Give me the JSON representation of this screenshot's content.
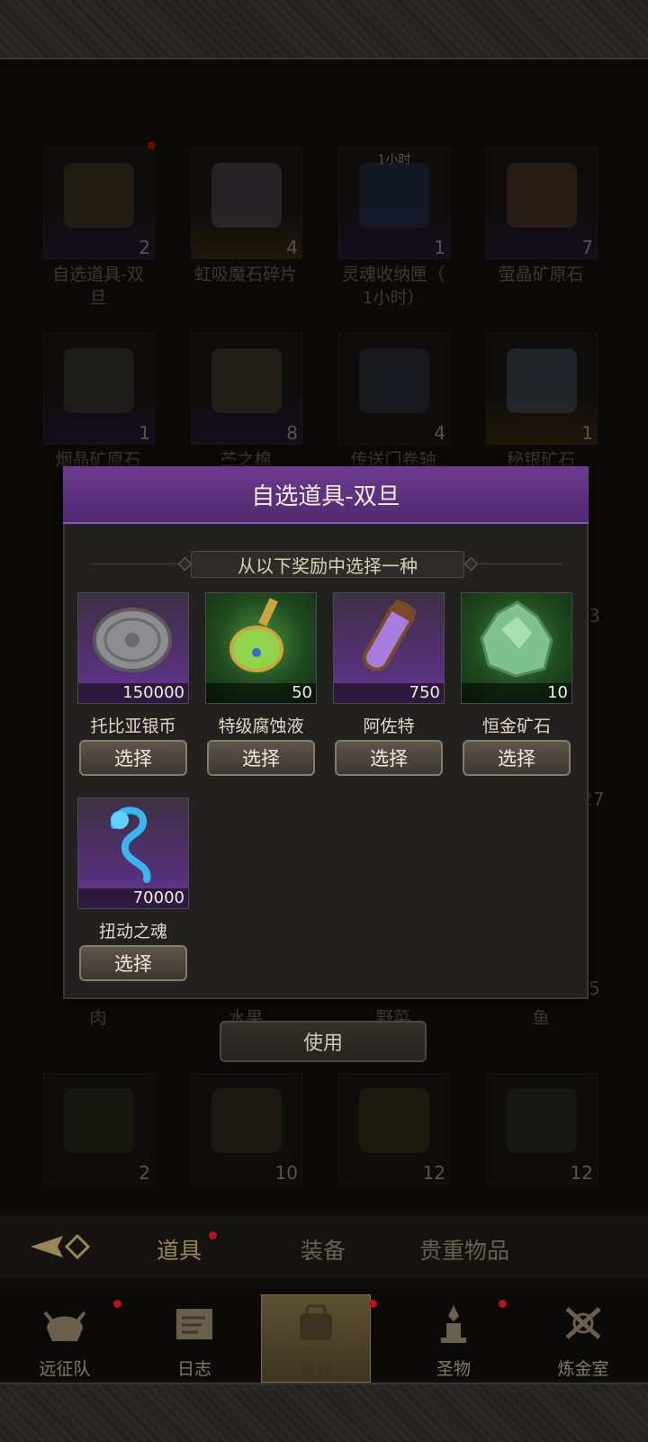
{
  "inventory": {
    "row1": [
      {
        "label": "自选道具-双\n旦",
        "count": "2",
        "note": ""
      },
      {
        "label": "虹吸魔石碎片",
        "count": "4",
        "note": ""
      },
      {
        "label": "灵魂收纳匣（\n1小时）",
        "count": "1",
        "note": "1小时"
      },
      {
        "label": "萤晶矿原石",
        "count": "7",
        "note": ""
      }
    ],
    "row2": [
      {
        "label": "烟晶矿原石",
        "count": "1"
      },
      {
        "label": "苎之棉",
        "count": "8"
      },
      {
        "label": "传送门卷轴",
        "count": "4"
      },
      {
        "label": "秘银矿石",
        "count": "1"
      }
    ],
    "row_labels_hidden": [
      "肉",
      "水果",
      "野菜",
      "鱼"
    ],
    "row_last": [
      {
        "count": "2"
      },
      {
        "count": "10"
      },
      {
        "count": "12"
      },
      {
        "count": "12"
      }
    ],
    "edge_counts": [
      "3",
      "27",
      "5"
    ]
  },
  "modal": {
    "title": "自选道具-双旦",
    "subtitle": "从以下奖励中选择一种",
    "select_label": "选择",
    "rewards": [
      {
        "name": "托比亚银币",
        "count": "150000",
        "icon": "silver-coin-icon"
      },
      {
        "name": "特级腐蚀液",
        "count": "50",
        "icon": "potion-flask-icon"
      },
      {
        "name": "阿佐特",
        "count": "750",
        "icon": "crystal-vial-icon"
      },
      {
        "name": "恒金矿石",
        "count": "10",
        "icon": "green-ore-icon"
      },
      {
        "name": "扭动之魂",
        "count": "70000",
        "icon": "wisp-soul-icon"
      }
    ]
  },
  "use_button": "使用",
  "tabs": [
    {
      "label": "道具",
      "active": true
    },
    {
      "label": "装备",
      "active": false
    },
    {
      "label": "贵重物品",
      "active": false
    }
  ],
  "nav": [
    {
      "label": "远征队",
      "icon": "helmet-icon",
      "active": false
    },
    {
      "label": "日志",
      "icon": "scroll-icon",
      "active": false
    },
    {
      "label": "背包",
      "icon": "backpack-icon",
      "active": true
    },
    {
      "label": "圣物",
      "icon": "relic-icon",
      "active": false
    },
    {
      "label": "炼金室",
      "icon": "alchemy-icon",
      "active": false
    }
  ],
  "colors": {
    "accent_purple": "#5e3380",
    "badge_red": "#b3151a",
    "gold": "#9a8556"
  }
}
